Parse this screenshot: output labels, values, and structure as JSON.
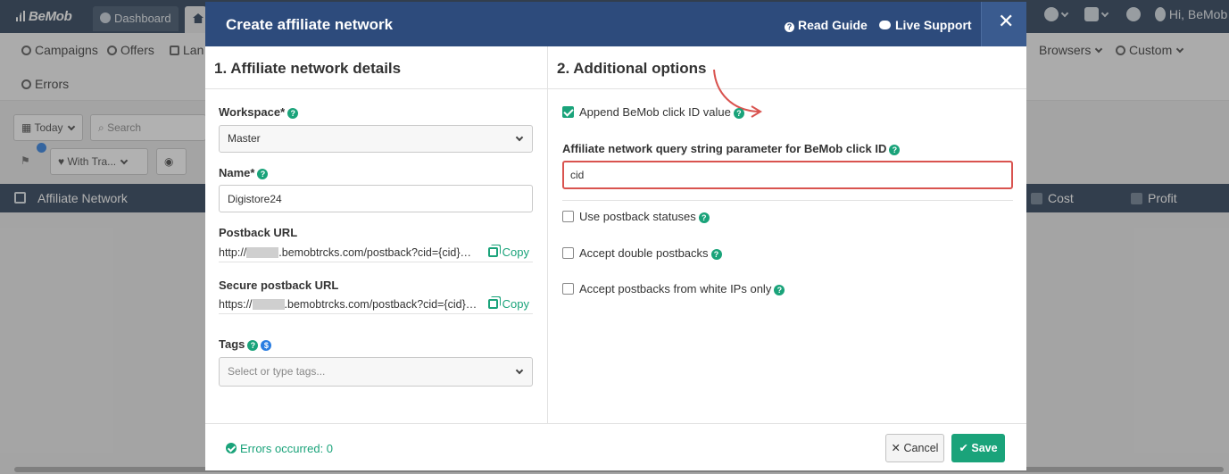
{
  "app": {
    "logo": "BeMob",
    "tab_dashboard": "Dashboard",
    "user_greeting": "Hi, BeMob"
  },
  "nav": {
    "campaigns": "Campaigns",
    "offers": "Offers",
    "landers_partial": "Lan",
    "browsers": "Browsers",
    "custom": "Custom",
    "errors": "Errors"
  },
  "filters": {
    "date": "Today",
    "search_placeholder": "Search",
    "traffic": "With Tra..."
  },
  "table": {
    "col_affiliate": "Affiliate Network",
    "col_cost": "Cost",
    "col_profit": "Profit"
  },
  "modal": {
    "title": "Create affiliate network",
    "read_guide": "Read Guide",
    "live_support": "Live Support",
    "close": "✕",
    "left_title": "1. Affiliate network details",
    "right_title": "2. Additional options",
    "workspace_label": "Workspace*",
    "workspace_value": "Master",
    "name_label": "Name*",
    "name_value": "Digistore24",
    "postback_label": "Postback URL",
    "postback_prefix": "http://",
    "postback_suffix": ".bemobtrcks.com/postback?cid={cid}&payout={payout}",
    "secure_label": "Secure postback URL",
    "secure_prefix": "https://",
    "secure_suffix": ".bemobtrcks.com/postback?cid={cid}&payout={payout}",
    "copy": "Copy",
    "tags_label": "Tags",
    "tags_placeholder": "Select or type tags...",
    "append_label": "Append BeMob click ID value",
    "append_checked": true,
    "qs_label": "Affiliate network query string parameter for BeMob click ID",
    "qs_value": "cid",
    "postback_statuses": "Use postback statuses",
    "double_postbacks": "Accept double postbacks",
    "white_ips": "Accept postbacks from white IPs only",
    "errors_status": "Errors occurred: 0",
    "cancel": "Cancel",
    "save": "Save"
  },
  "colors": {
    "header_bg": "#253a53",
    "modal_header": "#2d4b7c",
    "accent_green": "#1aa37a",
    "highlight_red": "#d9534f"
  }
}
